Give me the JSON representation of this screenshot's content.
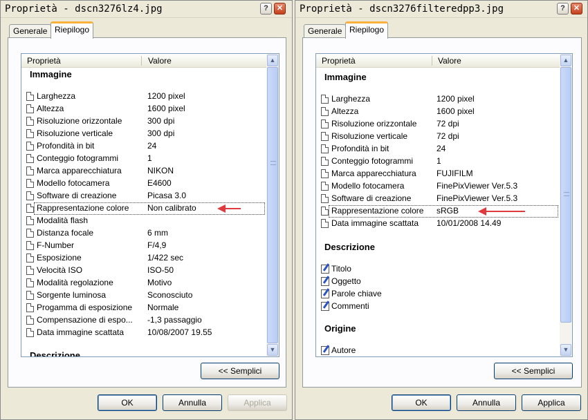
{
  "left": {
    "title": "Proprietà - dscn3276lz4.jpg",
    "help_glyph": "?",
    "close_glyph": "✕",
    "tabs": [
      {
        "label": "Generale"
      },
      {
        "label": "Riepilogo"
      }
    ],
    "columns": {
      "property": "Proprietà",
      "value": "Valore"
    },
    "groups": {
      "image": "Immagine",
      "description": "Descrizione"
    },
    "rows": [
      {
        "label": "Larghezza",
        "value": "1200 pixel"
      },
      {
        "label": "Altezza",
        "value": "1600 pixel"
      },
      {
        "label": "Risoluzione orizzontale",
        "value": "300 dpi"
      },
      {
        "label": "Risoluzione verticale",
        "value": "300 dpi"
      },
      {
        "label": "Profondità in bit",
        "value": "24"
      },
      {
        "label": "Conteggio fotogrammi",
        "value": "1"
      },
      {
        "label": "Marca apparecchiatura",
        "value": "NIKON"
      },
      {
        "label": "Modello fotocamera",
        "value": "E4600"
      },
      {
        "label": "Software di creazione",
        "value": "Picasa 3.0"
      },
      {
        "label": "Rappresentazione colore",
        "value": "Non calibrato"
      },
      {
        "label": "Modalità flash",
        "value": ""
      },
      {
        "label": "Distanza focale",
        "value": "6 mm"
      },
      {
        "label": "F-Number",
        "value": "F/4,9"
      },
      {
        "label": "Esposizione",
        "value": "1/422 sec"
      },
      {
        "label": "Velocità ISO",
        "value": "ISO-50"
      },
      {
        "label": "Modalità regolazione",
        "value": "Motivo"
      },
      {
        "label": "Sorgente luminosa",
        "value": "Sconosciuto"
      },
      {
        "label": "Progamma di esposizione",
        "value": "Normale"
      },
      {
        "label": "Compensazione di espo...",
        "value": "-1,3 passaggio"
      },
      {
        "label": "Data immagine scattata",
        "value": "10/08/2007 19.55"
      }
    ],
    "simple_button": "<< Semplici",
    "ok_button": "OK",
    "cancel_button": "Annulla",
    "apply_button": "Applica"
  },
  "right": {
    "title": "Proprietà - dscn3276filteredpp3.jpg",
    "help_glyph": "?",
    "close_glyph": "✕",
    "tabs": [
      {
        "label": "Generale"
      },
      {
        "label": "Riepilogo"
      }
    ],
    "columns": {
      "property": "Proprietà",
      "value": "Valore"
    },
    "groups": {
      "image": "Immagine",
      "description": "Descrizione",
      "origin": "Origine"
    },
    "rows": [
      {
        "label": "Larghezza",
        "value": "1200 pixel"
      },
      {
        "label": "Altezza",
        "value": "1600 pixel"
      },
      {
        "label": "Risoluzione orizzontale",
        "value": "72 dpi"
      },
      {
        "label": "Risoluzione verticale",
        "value": "72 dpi"
      },
      {
        "label": "Profondità in bit",
        "value": "24"
      },
      {
        "label": "Conteggio fotogrammi",
        "value": "1"
      },
      {
        "label": "Marca apparecchiatura",
        "value": "FUJIFILM"
      },
      {
        "label": "Modello fotocamera",
        "value": "FinePixViewer Ver.5.3"
      },
      {
        "label": "Software di creazione",
        "value": "FinePixViewer Ver.5.3"
      },
      {
        "label": "Rappresentazione colore",
        "value": "sRGB"
      },
      {
        "label": "Data immagine scattata",
        "value": "10/01/2008 14.49"
      }
    ],
    "description_rows": [
      {
        "label": "Titolo"
      },
      {
        "label": "Oggetto"
      },
      {
        "label": "Parole chiave"
      },
      {
        "label": "Commenti"
      }
    ],
    "origin_rows": [
      {
        "label": "Autore"
      }
    ],
    "simple_button": "<< Semplici",
    "ok_button": "OK",
    "cancel_button": "Annulla",
    "apply_button": "Applica"
  },
  "scroll_arrows": {
    "up": "▲",
    "down": "▼"
  },
  "colors": {
    "annotation_arrow": "#e0393e",
    "active_tab_accent": "#f9b13b",
    "dialog_bg": "#ece9d8"
  }
}
